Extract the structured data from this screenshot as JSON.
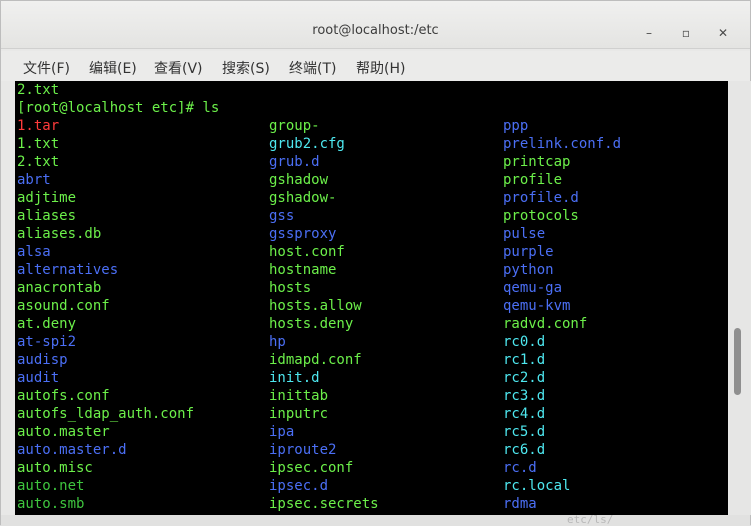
{
  "window": {
    "title": "root@localhost:/etc",
    "minimize": "–",
    "maximize": "▫",
    "close": "✕"
  },
  "menu": [
    "文件(F)",
    "编辑(E)",
    "查看(V)",
    "搜索(S)",
    "终端(T)",
    "帮助(H)"
  ],
  "terminal": {
    "prev_line": "2.txt",
    "prompt": "[root@localhost etc]# ls",
    "columns": [
      [
        {
          "t": "1.tar",
          "c": "#ff3b3b"
        },
        {
          "t": "1.txt",
          "c": "#6cf04a"
        },
        {
          "t": "2.txt",
          "c": "#6cf04a"
        },
        {
          "t": "abrt",
          "c": "#4b6ff5"
        },
        {
          "t": "adjtime",
          "c": "#6cf04a"
        },
        {
          "t": "aliases",
          "c": "#6cf04a"
        },
        {
          "t": "aliases.db",
          "c": "#6cf04a"
        },
        {
          "t": "alsa",
          "c": "#4b6ff5"
        },
        {
          "t": "alternatives",
          "c": "#4b6ff5"
        },
        {
          "t": "anacrontab",
          "c": "#6cf04a"
        },
        {
          "t": "asound.conf",
          "c": "#6cf04a"
        },
        {
          "t": "at.deny",
          "c": "#6cf04a"
        },
        {
          "t": "at-spi2",
          "c": "#4b6ff5"
        },
        {
          "t": "audisp",
          "c": "#4b6ff5"
        },
        {
          "t": "audit",
          "c": "#4b6ff5"
        },
        {
          "t": "autofs.conf",
          "c": "#6cf04a"
        },
        {
          "t": "autofs_ldap_auth.conf",
          "c": "#6cf04a"
        },
        {
          "t": "auto.master",
          "c": "#6cf04a"
        },
        {
          "t": "auto.master.d",
          "c": "#4b6ff5"
        },
        {
          "t": "auto.misc",
          "c": "#6cf04a"
        },
        {
          "t": "auto.net",
          "c": "#3ec53e"
        },
        {
          "t": "auto.smb",
          "c": "#3ec53e"
        }
      ],
      [
        {
          "t": "group-",
          "c": "#6cf04a"
        },
        {
          "t": "grub2.cfg",
          "c": "#4ee8f0"
        },
        {
          "t": "grub.d",
          "c": "#4b6ff5"
        },
        {
          "t": "gshadow",
          "c": "#6cf04a"
        },
        {
          "t": "gshadow-",
          "c": "#6cf04a"
        },
        {
          "t": "gss",
          "c": "#4b6ff5"
        },
        {
          "t": "gssproxy",
          "c": "#4b6ff5"
        },
        {
          "t": "host.conf",
          "c": "#6cf04a"
        },
        {
          "t": "hostname",
          "c": "#6cf04a"
        },
        {
          "t": "hosts",
          "c": "#6cf04a"
        },
        {
          "t": "hosts.allow",
          "c": "#6cf04a"
        },
        {
          "t": "hosts.deny",
          "c": "#6cf04a"
        },
        {
          "t": "hp",
          "c": "#4b6ff5"
        },
        {
          "t": "idmapd.conf",
          "c": "#6cf04a"
        },
        {
          "t": "init.d",
          "c": "#4ee8f0"
        },
        {
          "t": "inittab",
          "c": "#6cf04a"
        },
        {
          "t": "inputrc",
          "c": "#6cf04a"
        },
        {
          "t": "ipa",
          "c": "#4b6ff5"
        },
        {
          "t": "iproute2",
          "c": "#4b6ff5"
        },
        {
          "t": "ipsec.conf",
          "c": "#6cf04a"
        },
        {
          "t": "ipsec.d",
          "c": "#4b6ff5"
        },
        {
          "t": "ipsec.secrets",
          "c": "#6cf04a"
        }
      ],
      [
        {
          "t": "ppp",
          "c": "#4b6ff5"
        },
        {
          "t": "prelink.conf.d",
          "c": "#4b6ff5"
        },
        {
          "t": "printcap",
          "c": "#6cf04a"
        },
        {
          "t": "profile",
          "c": "#6cf04a"
        },
        {
          "t": "profile.d",
          "c": "#4b6ff5"
        },
        {
          "t": "protocols",
          "c": "#6cf04a"
        },
        {
          "t": "pulse",
          "c": "#4b6ff5"
        },
        {
          "t": "purple",
          "c": "#4b6ff5"
        },
        {
          "t": "python",
          "c": "#4b6ff5"
        },
        {
          "t": "qemu-ga",
          "c": "#4b6ff5"
        },
        {
          "t": "qemu-kvm",
          "c": "#4b6ff5"
        },
        {
          "t": "radvd.conf",
          "c": "#6cf04a"
        },
        {
          "t": "rc0.d",
          "c": "#4ee8f0"
        },
        {
          "t": "rc1.d",
          "c": "#4ee8f0"
        },
        {
          "t": "rc2.d",
          "c": "#4ee8f0"
        },
        {
          "t": "rc3.d",
          "c": "#4ee8f0"
        },
        {
          "t": "rc4.d",
          "c": "#4ee8f0"
        },
        {
          "t": "rc5.d",
          "c": "#4ee8f0"
        },
        {
          "t": "rc6.d",
          "c": "#4ee8f0"
        },
        {
          "t": "rc.d",
          "c": "#4b6ff5"
        },
        {
          "t": "rc.local",
          "c": "#4ee8f0"
        },
        {
          "t": "rdma",
          "c": "#4b6ff5"
        }
      ]
    ]
  },
  "colors": {
    "terminal_bg": "#000000",
    "prompt_fg": "#6cf04a"
  },
  "ghost_text": "etc/ls/"
}
